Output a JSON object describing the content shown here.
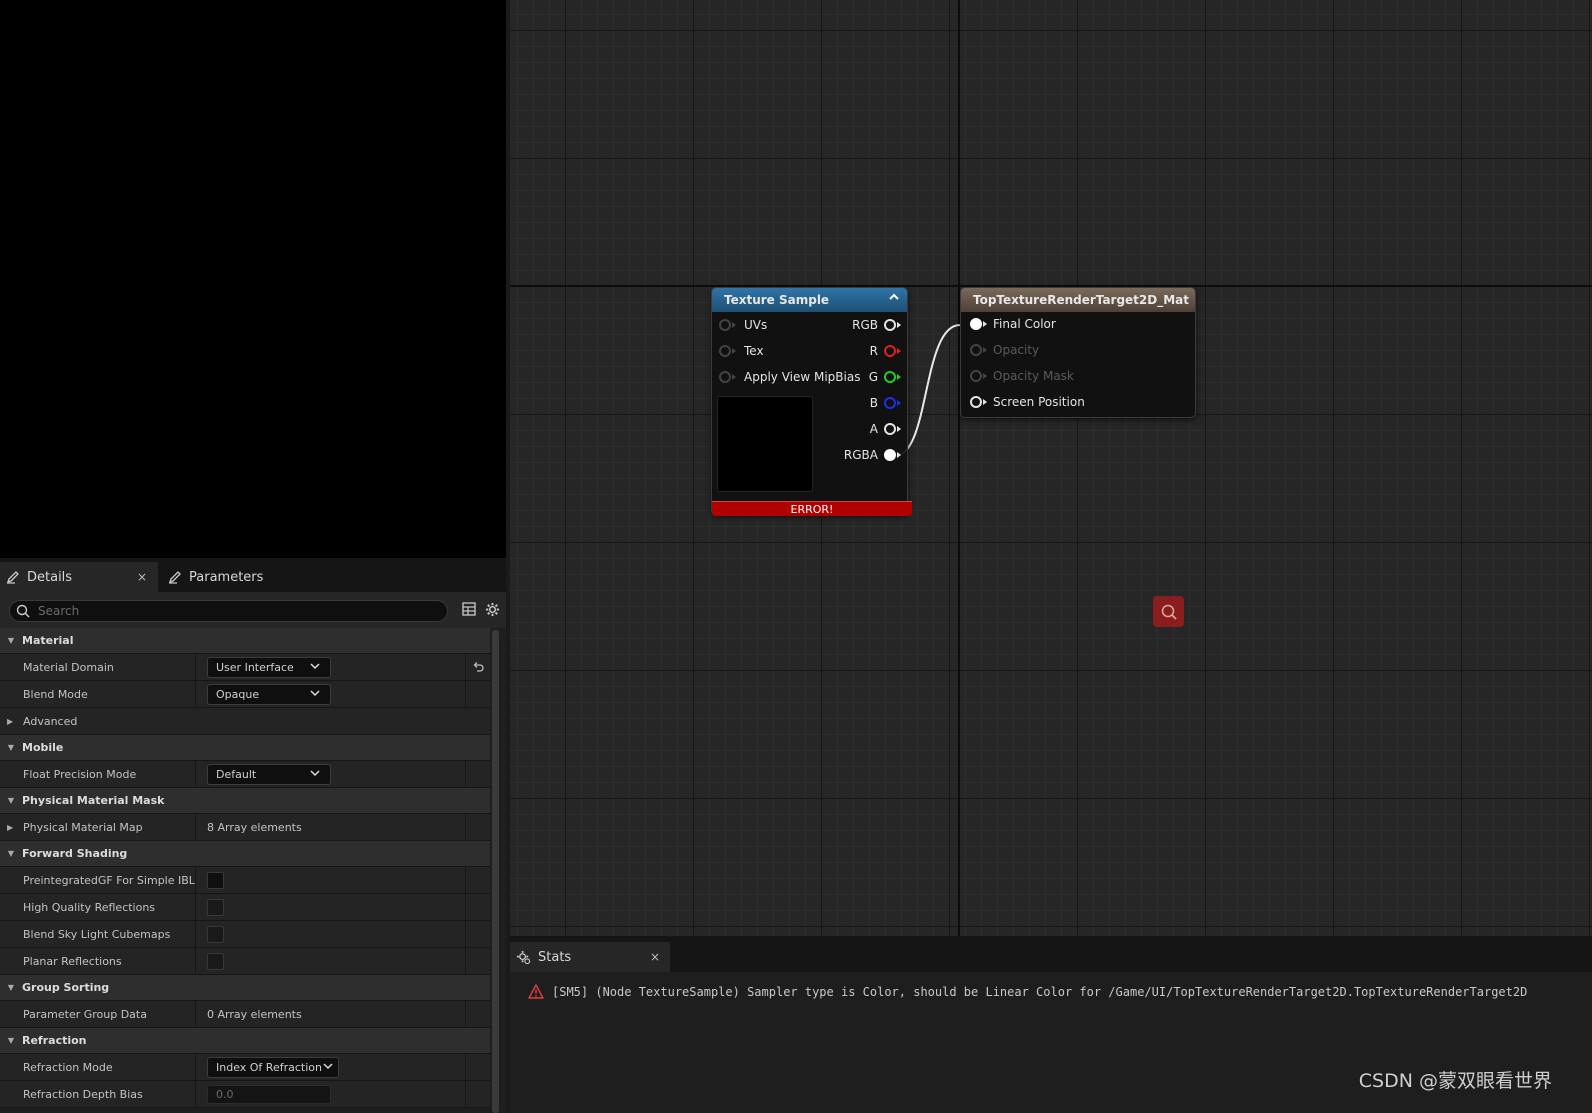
{
  "details": {
    "tab_details": "Details",
    "tab_close": "×",
    "tab_parameters": "Parameters",
    "search_placeholder": "Search",
    "categories": {
      "material": "Material",
      "mobile": "Mobile",
      "physical_material_mask": "Physical Material Mask",
      "forward_shading": "Forward Shading",
      "group_sorting": "Group Sorting",
      "refraction": "Refraction"
    },
    "rows": {
      "material_domain": {
        "label": "Material Domain",
        "value": "User Interface"
      },
      "blend_mode": {
        "label": "Blend Mode",
        "value": "Opaque"
      },
      "advanced": {
        "label": "Advanced"
      },
      "float_precision_mode": {
        "label": "Float Precision Mode",
        "value": "Default"
      },
      "physical_material_map": {
        "label": "Physical Material Map",
        "value": "8 Array elements"
      },
      "preintegrated_gf": {
        "label": "PreintegratedGF For Simple IBL"
      },
      "high_quality_reflections": {
        "label": "High Quality Reflections"
      },
      "blend_sky_light_cubemaps": {
        "label": "Blend Sky Light Cubemaps"
      },
      "planar_reflections": {
        "label": "Planar Reflections"
      },
      "parameter_group_data": {
        "label": "Parameter Group Data",
        "value": "0 Array elements"
      },
      "refraction_mode": {
        "label": "Refraction Mode",
        "value": "Index Of Refraction"
      },
      "refraction_depth_bias": {
        "label": "Refraction Depth Bias",
        "value": "0.0"
      }
    }
  },
  "graph": {
    "texture_sample": {
      "title": "Texture Sample",
      "inputs": [
        "UVs",
        "Tex",
        "Apply View MipBias"
      ],
      "outputs": [
        "RGB",
        "R",
        "G",
        "B",
        "A",
        "RGBA"
      ],
      "error": "ERROR!"
    },
    "result_node": {
      "title": "TopTextureRenderTarget2D_Mat",
      "inputs": [
        "Final Color",
        "Opacity",
        "Opacity Mask",
        "Screen Position"
      ]
    }
  },
  "stats": {
    "tab_label": "Stats",
    "tab_close": "×",
    "message": "[SM5] (Node TextureSample) Sampler type is Color, should be Linear Color for /Game/UI/TopTextureRenderTarget2D.TopTextureRenderTarget2D"
  },
  "watermark": "CSDN @蒙双眼看世界",
  "colors": {
    "texture_header": "#2a6796",
    "result_header": "#6b5a4a",
    "error_bar": "#b00000",
    "pin_red": "#e02020",
    "pin_green": "#20d020",
    "pin_blue": "#2030e0"
  }
}
